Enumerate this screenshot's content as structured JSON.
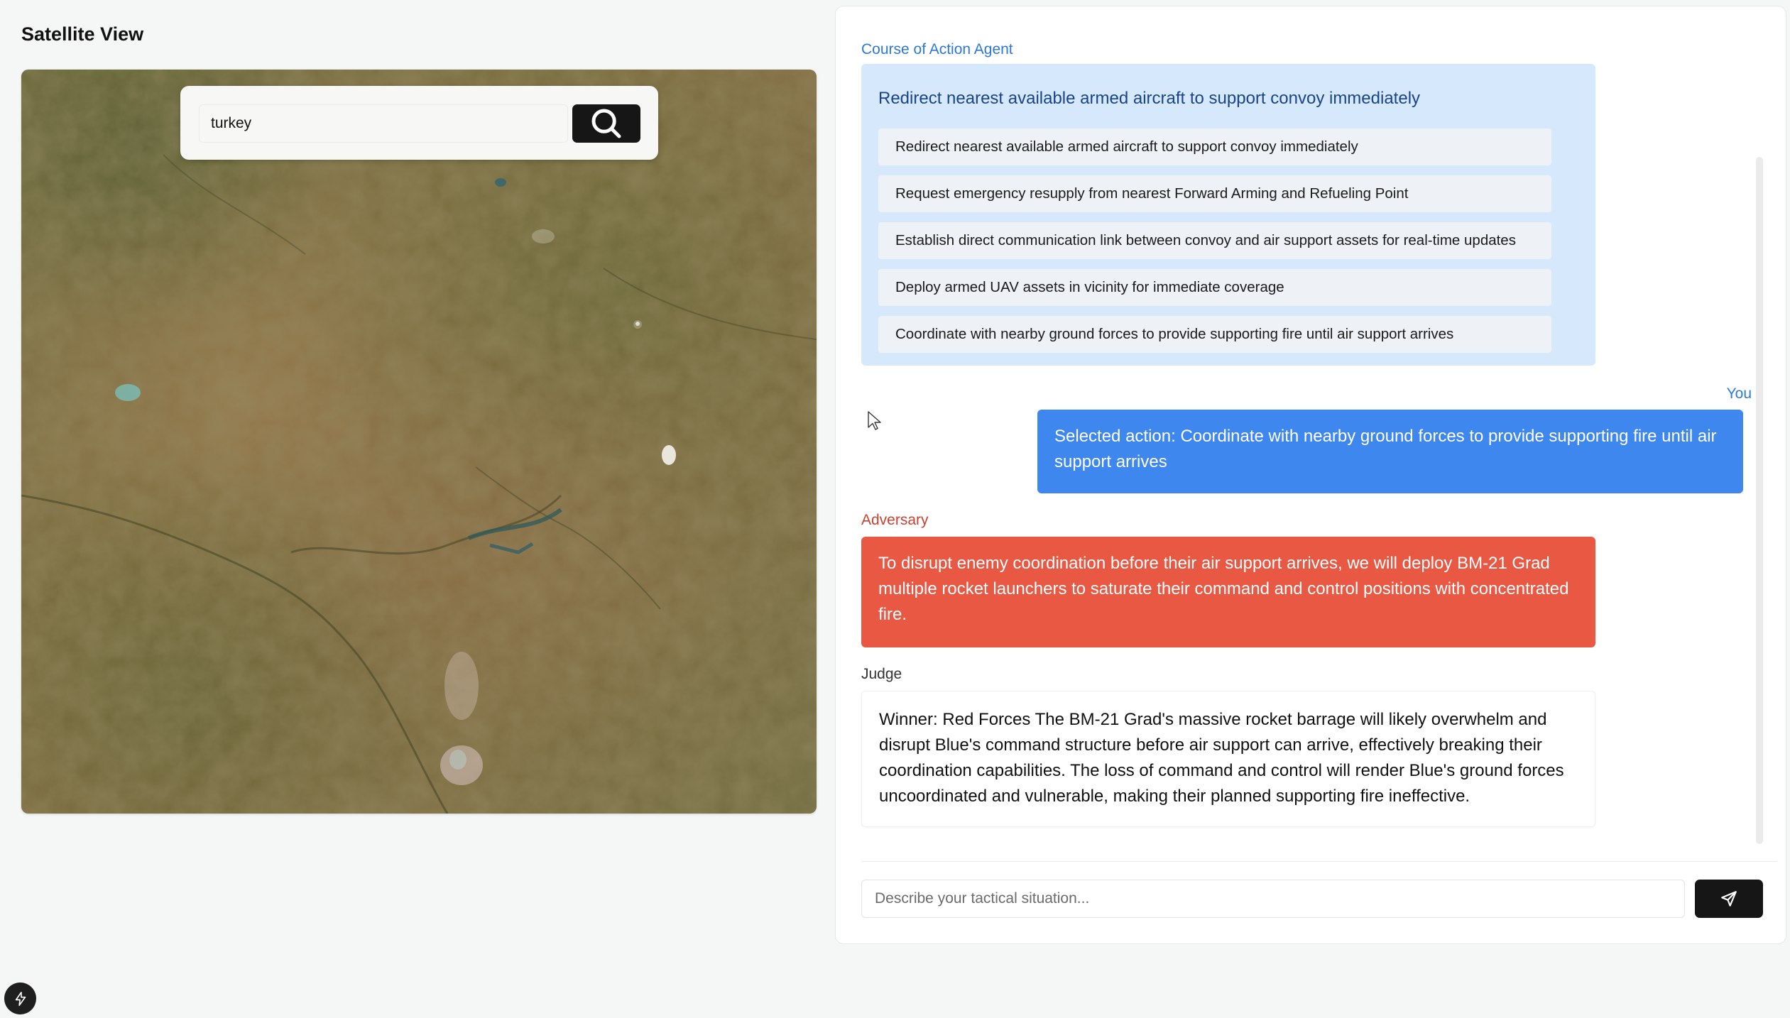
{
  "satellite": {
    "title": "Satellite View",
    "search_value": "turkey",
    "search_icon": "search-icon"
  },
  "coa": {
    "agent_label": "Course of Action Agent",
    "headline": "Redirect nearest available armed aircraft to support convoy immediately",
    "options": [
      "Redirect nearest available armed aircraft to support convoy immediately",
      "Request emergency resupply from nearest Forward Arming and Refueling Point",
      "Establish direct communication link between convoy and air support assets for real-time updates",
      "Deploy armed UAV assets in vicinity for immediate coverage",
      "Coordinate with nearby ground forces to provide supporting fire until air support arrives"
    ]
  },
  "user_message": {
    "label": "You",
    "text": "Selected action: Coordinate with nearby ground forces to provide supporting fire until air support arrives"
  },
  "adversary": {
    "label": "Adversary",
    "text": "To disrupt enemy coordination before their air support arrives, we will deploy BM-21 Grad multiple rocket launchers to saturate their command and control positions with concentrated fire."
  },
  "judge": {
    "label": "Judge",
    "text": "Winner: Red Forces The BM-21 Grad's massive rocket barrage will likely overwhelm and disrupt Blue's command structure before air support can arrive, effectively breaking their coordination capabilities. The loss of command and control will render Blue's ground forces uncoordinated and vulnerable, making their planned supporting fire ineffective."
  },
  "chat_input": {
    "placeholder": "Describe your tactical situation...",
    "send_icon": "send-icon"
  },
  "colors": {
    "agent": "#2c79d4",
    "coa_card": "#d6e8fb",
    "user_bubble": "#3e87ee",
    "adversary_bubble": "#e85842",
    "button_dark": "#161616"
  }
}
